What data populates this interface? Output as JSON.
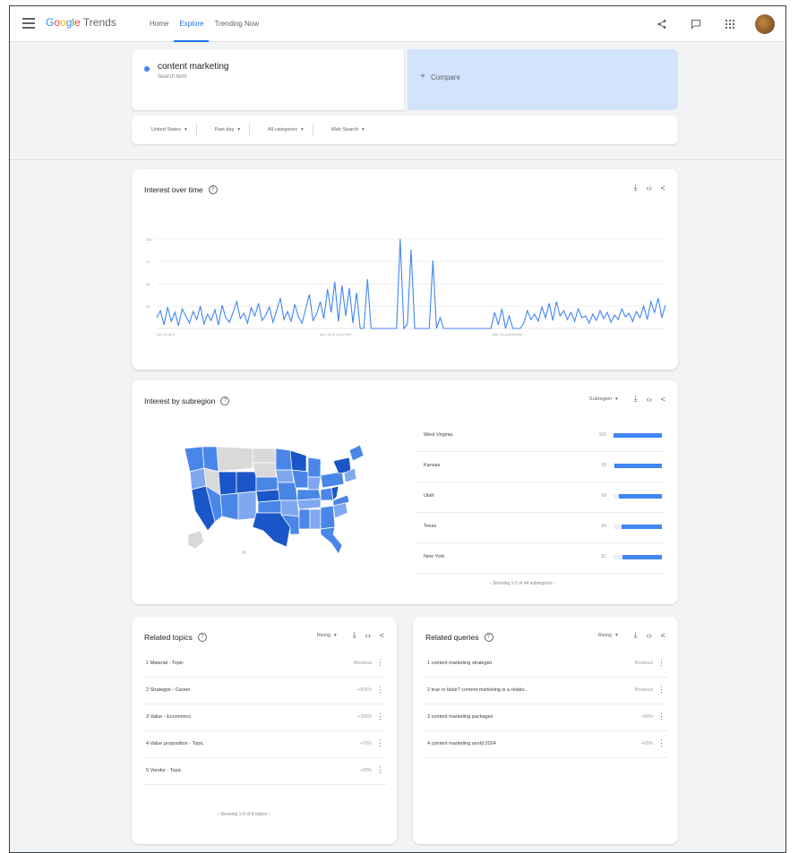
{
  "app": {
    "logo_google": [
      "G",
      "o",
      "o",
      "g",
      "l",
      "e"
    ],
    "logo_trends": "Trends"
  },
  "nav": {
    "items": [
      "Home",
      "Explore",
      "Trending Now"
    ],
    "active": 1
  },
  "search": {
    "term": "content marketing",
    "term_type": "Search term",
    "compare_label": "Compare",
    "filters": [
      "United States",
      "Past day",
      "All categories",
      "Web Search"
    ]
  },
  "interest_over_time": {
    "title": "Interest over time",
    "x_labels": [
      "Oct 13 at 8...",
      "Nov 13 at 11:00 PM",
      "Nov 14 at 8:00 AM"
    ],
    "y_labels": [
      "100",
      "75",
      "50",
      "25"
    ]
  },
  "chart_data": {
    "type": "line",
    "title": "Interest over time",
    "ylim": [
      0,
      100
    ],
    "grid": true,
    "series": [
      {
        "name": "content marketing",
        "values": [
          12,
          20,
          4,
          24,
          8,
          18,
          3,
          22,
          14,
          6,
          19,
          10,
          25,
          5,
          16,
          9,
          21,
          4,
          26,
          12,
          7,
          18,
          30,
          11,
          17,
          6,
          23,
          14,
          28,
          9,
          15,
          24,
          7,
          20,
          34,
          10,
          19,
          8,
          27,
          13,
          6,
          22,
          38,
          9,
          16,
          30,
          11,
          44,
          18,
          52,
          8,
          48,
          14,
          45,
          6,
          40,
          0,
          0,
          55,
          0,
          0,
          0,
          0,
          0,
          0,
          0,
          0,
          100,
          0,
          5,
          88,
          0,
          0,
          0,
          0,
          0,
          76,
          0,
          12,
          0,
          0,
          0,
          0,
          0,
          0,
          0,
          0,
          0,
          0,
          0,
          0,
          0,
          0,
          18,
          4,
          22,
          0,
          14,
          0,
          0,
          0,
          6,
          20,
          10,
          16,
          8,
          24,
          12,
          28,
          9,
          30,
          14,
          20,
          10,
          18,
          8,
          22,
          12,
          14,
          6,
          16,
          9,
          20,
          11,
          18,
          7,
          15,
          10,
          22,
          13,
          17,
          8,
          19,
          12,
          25,
          10,
          30,
          18,
          34,
          12,
          26
        ]
      }
    ]
  },
  "subregion": {
    "title": "Interest by subregion",
    "select": "Subregion",
    "rows": [
      {
        "rank": "1",
        "name": "West Virginia",
        "value": "100"
      },
      {
        "rank": "2",
        "name": "Kansas",
        "value": "99"
      },
      {
        "rank": "3",
        "name": "Utah",
        "value": "89"
      },
      {
        "rank": "4",
        "name": "Texas",
        "value": "84"
      },
      {
        "rank": "5",
        "name": "New York",
        "value": "82"
      }
    ],
    "bar_fraction": [
      1.0,
      0.99,
      0.89,
      0.84,
      0.82
    ],
    "footer": "Showing 1-5 of 44 subregions"
  },
  "related_topics": {
    "title": "Related topics",
    "select": "Rising",
    "rows": [
      {
        "text": "1  Material - Topic",
        "value": "Breakout"
      },
      {
        "text": "2  Strategist - Career",
        "value": "+900%"
      },
      {
        "text": "3  Value - Economics",
        "value": "+300%"
      },
      {
        "text": "4  Value proposition - Topic",
        "value": "+70%"
      },
      {
        "text": "5  Vendor - Topic",
        "value": "+60%"
      }
    ],
    "footer": "Showing 1-5 of 8 topics"
  },
  "related_queries": {
    "title": "Related queries",
    "select": "Rising",
    "rows": [
      {
        "text": "1  content marketing strategist",
        "value": "Breakout"
      },
      {
        "text": "2  true or false? content marketing is a relatio...",
        "value": "Breakout"
      },
      {
        "text": "3  content marketing packages",
        "value": "+80%"
      },
      {
        "text": "4  content marketing world 2024",
        "value": "+60%"
      }
    ]
  },
  "colors": {
    "accent": "#1a73e8",
    "series": "#4285f4",
    "map_dark": "#1a56c7",
    "map_mid": "#4a86e8",
    "map_light": "#7fa8ef",
    "map_none": "#d9d9d9"
  }
}
